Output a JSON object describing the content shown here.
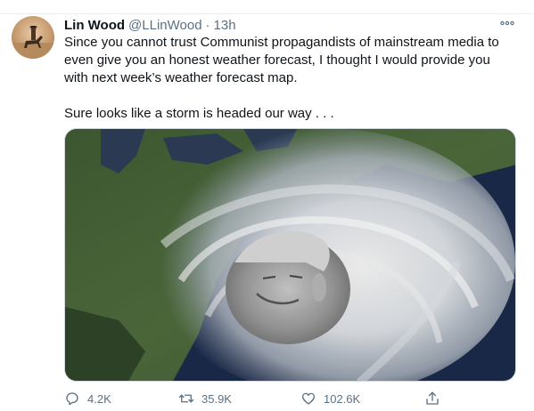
{
  "tweet": {
    "author_name": "Lin Wood",
    "handle": "@LLinWood",
    "separator": "·",
    "time": "13h",
    "text": "Since you cannot trust Communist propagandists of mainstream media to\neven give you an honest weather forecast, I thought I would provide you\nwith next week’s weather forecast map.\n\nSure looks like a storm is headed our way . . ."
  },
  "actions": {
    "reply_count": "4.2K",
    "retweet_count": "35.9K",
    "like_count": "102.6K"
  },
  "colors": {
    "text_primary": "#0f1419",
    "text_secondary": "#5b7083",
    "border": "#ebeef0"
  },
  "icons": [
    "more-icon",
    "reply-icon",
    "retweet-icon",
    "like-icon",
    "share-icon"
  ]
}
